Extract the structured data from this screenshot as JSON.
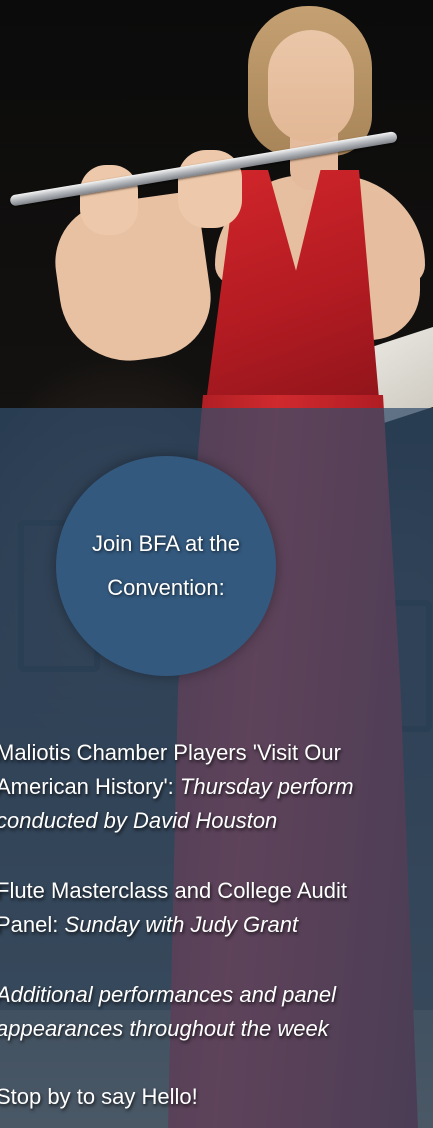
{
  "badge": {
    "line1": "Join BFA at the",
    "line2": "Convention:"
  },
  "events": [
    {
      "title_line1": "Maliotis Chamber Players 'Visit Our",
      "title_line2": "American History':",
      "detail_line2": "Thursday perform",
      "detail_line3": "conducted by David Houston"
    },
    {
      "title_line1": "Flute Masterclass and College Audit",
      "title_line2": "Panel:",
      "detail_line2": "Sunday with Judy Grant"
    },
    {
      "detail_line1": "Additional performances and panel",
      "detail_line2": "appearances throughout the week"
    }
  ],
  "footer_text": "Stop by to say Hello!",
  "colors": {
    "overlay": "#324e6c",
    "badge": "#33597e",
    "text": "#ffffff",
    "dress": "#c8252b"
  }
}
